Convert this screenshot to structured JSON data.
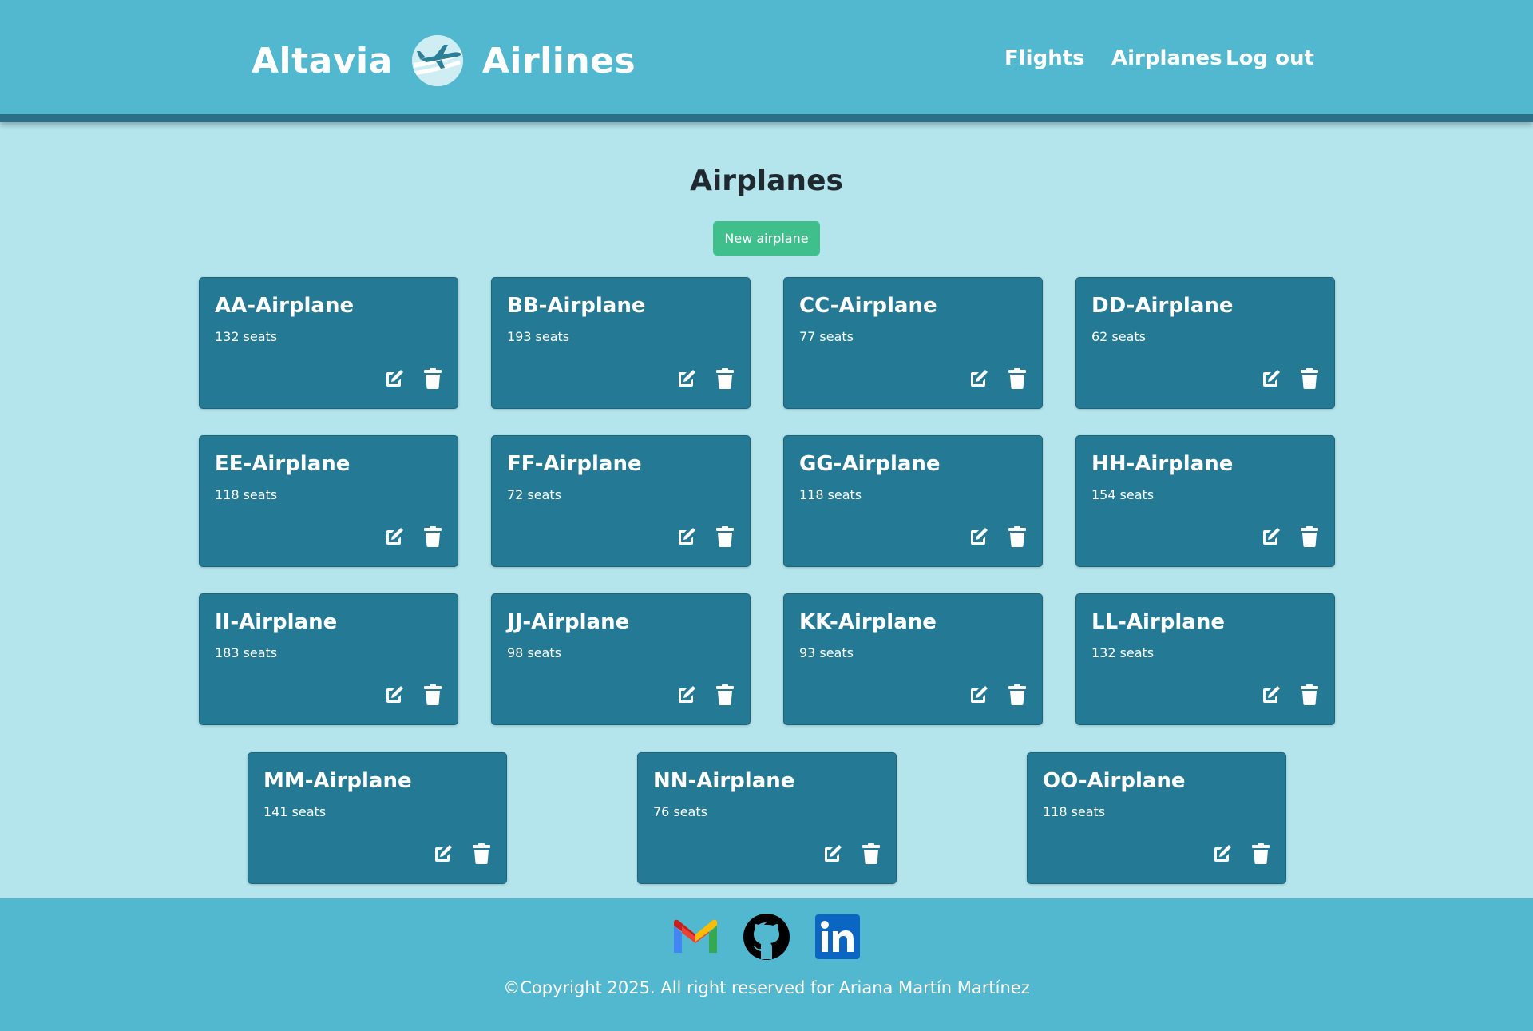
{
  "header": {
    "brand_left": "Altavia",
    "brand_right": "Airlines",
    "nav": {
      "flights": "Flights",
      "airplanes": "Airplanes",
      "logout": "Log out"
    }
  },
  "main": {
    "title": "Airplanes",
    "new_button": "New airplane",
    "seats_suffix": "seats",
    "airplanes": [
      {
        "name": "AA-Airplane",
        "seats": "132"
      },
      {
        "name": "BB-Airplane",
        "seats": "193"
      },
      {
        "name": "CC-Airplane",
        "seats": "77"
      },
      {
        "name": "DD-Airplane",
        "seats": "62"
      },
      {
        "name": "EE-Airplane",
        "seats": "118"
      },
      {
        "name": "FF-Airplane",
        "seats": "72"
      },
      {
        "name": "GG-Airplane",
        "seats": "118"
      },
      {
        "name": "HH-Airplane",
        "seats": "154"
      },
      {
        "name": "II-Airplane",
        "seats": "183"
      },
      {
        "name": "JJ-Airplane",
        "seats": "98"
      },
      {
        "name": "KK-Airplane",
        "seats": "93"
      },
      {
        "name": "LL-Airplane",
        "seats": "132"
      },
      {
        "name": "MM-Airplane",
        "seats": "141"
      },
      {
        "name": "NN-Airplane",
        "seats": "76"
      },
      {
        "name": "OO-Airplane",
        "seats": "118"
      }
    ]
  },
  "footer": {
    "icons": [
      "gmail-icon",
      "github-icon",
      "linkedin-icon"
    ],
    "copyright": "©Copyright 2025. All right reserved for Ariana Martín Martínez"
  },
  "colors": {
    "header_bg": "#52b8cf",
    "page_bg": "#b5e5ec",
    "card_bg": "#247a95",
    "button_green": "#3fbf8b"
  }
}
